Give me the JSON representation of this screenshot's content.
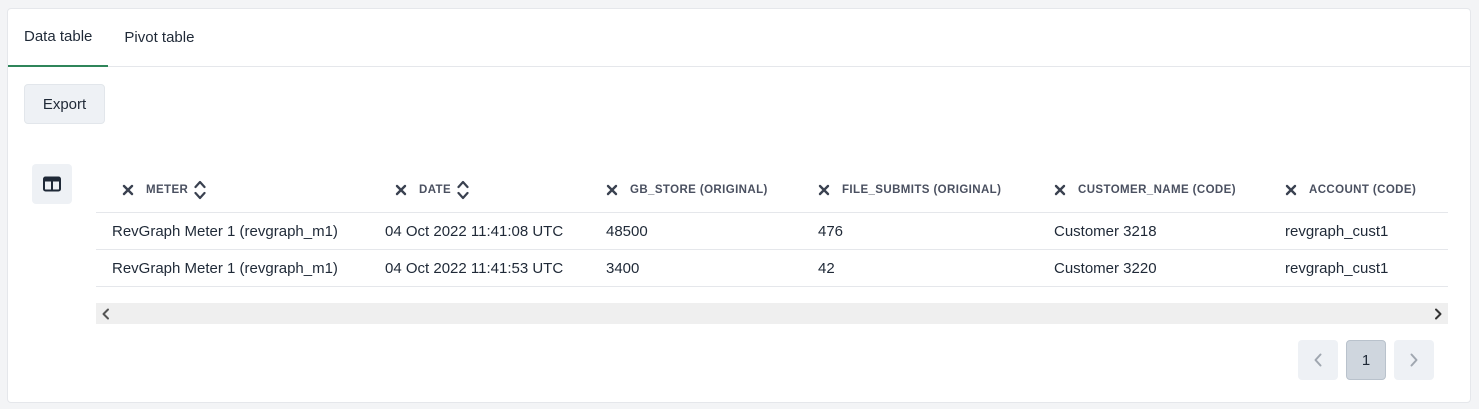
{
  "tabs": [
    {
      "label": "Data table",
      "active": true
    },
    {
      "label": "Pivot table",
      "active": false
    }
  ],
  "toolbar": {
    "export_label": "Export",
    "columns_icon": "table-columns-icon"
  },
  "table": {
    "headers": [
      {
        "label": "METER",
        "sortable": true
      },
      {
        "label": "DATE",
        "sortable": true
      },
      {
        "label": "GB_STORE (ORIGINAL)",
        "sortable": false
      },
      {
        "label": "FILE_SUBMITS (ORIGINAL)",
        "sortable": false
      },
      {
        "label": "CUSTOMER_NAME (CODE)",
        "sortable": false
      },
      {
        "label": "ACCOUNT (CODE)",
        "sortable": false
      }
    ],
    "rows": [
      [
        "RevGraph Meter 1 (revgraph_m1)",
        "04 Oct 2022 11:41:08 UTC",
        "48500",
        "476",
        "Customer 3218",
        "revgraph_cust1"
      ],
      [
        "RevGraph Meter 1 (revgraph_m1)",
        "04 Oct 2022 11:41:53 UTC",
        "3400",
        "42",
        "Customer 3220",
        "revgraph_cust1"
      ]
    ]
  },
  "pagination": {
    "current_page": "1"
  },
  "colors": {
    "accent": "#2f855a",
    "button_bg": "#eef1f5",
    "current_page_bg": "#cfd6de"
  }
}
